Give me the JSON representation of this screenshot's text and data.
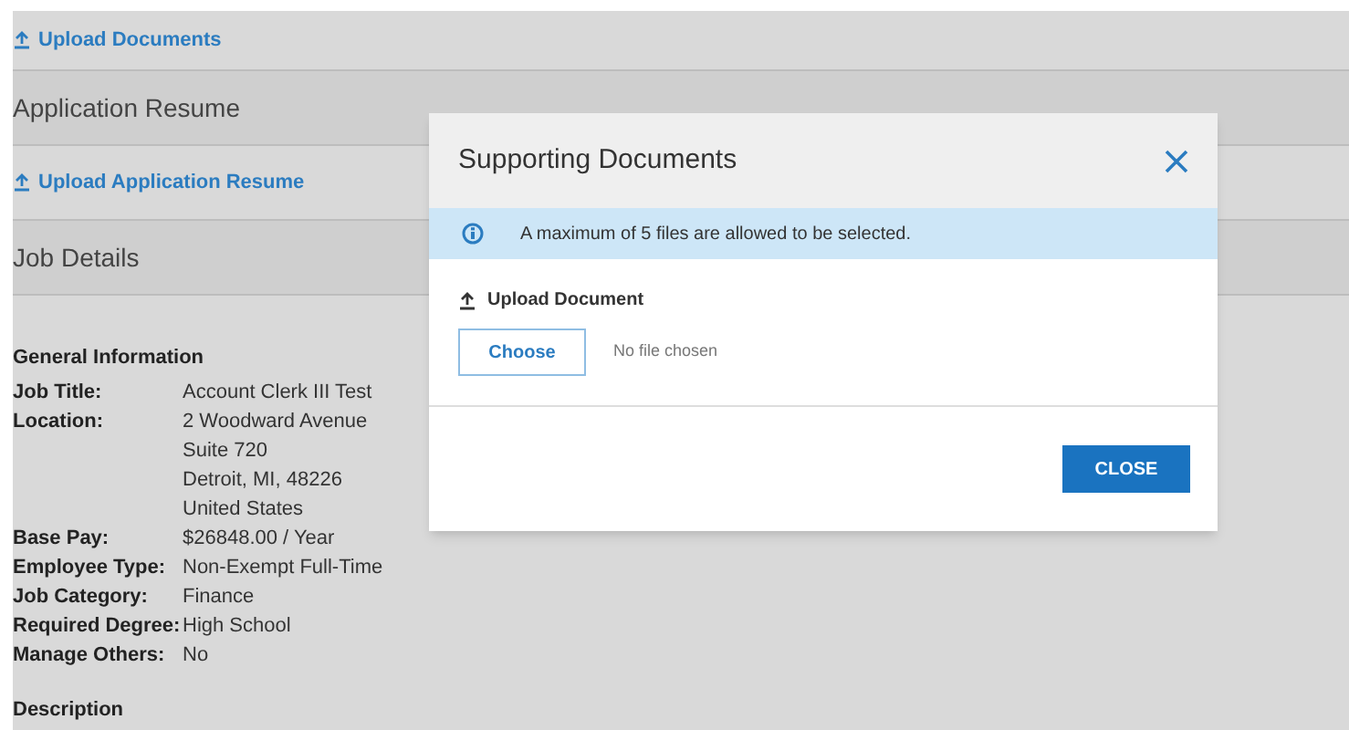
{
  "page": {
    "upload_documents_link": "Upload Documents",
    "sections": [
      {
        "title": "Application Resume",
        "link": "Upload Application Resume"
      },
      {
        "title": "Job Details"
      }
    ],
    "general_information": {
      "heading": "General Information",
      "fields": [
        {
          "label": "Job Title:",
          "lines": [
            "Account Clerk III Test"
          ]
        },
        {
          "label": "Location:",
          "lines": [
            "2 Woodward Avenue",
            "Suite 720",
            "Detroit, MI, 48226",
            "United States"
          ]
        },
        {
          "label": "Base Pay:",
          "lines": [
            "$26848.00 / Year"
          ]
        },
        {
          "label": "Employee Type:",
          "lines": [
            "Non-Exempt Full-Time"
          ]
        },
        {
          "label": "Job Category:",
          "lines": [
            "Finance"
          ]
        },
        {
          "label": "Required Degree:",
          "lines": [
            "High School"
          ]
        },
        {
          "label": "Manage Others:",
          "lines": [
            "No"
          ]
        }
      ]
    },
    "description_heading": "Description"
  },
  "dialog": {
    "title": "Supporting Documents",
    "info": "A maximum of 5 files are allowed to be selected.",
    "upload_label": "Upload Document",
    "choose_button": "Choose",
    "file_status": "No file chosen",
    "close_button": "CLOSE"
  }
}
